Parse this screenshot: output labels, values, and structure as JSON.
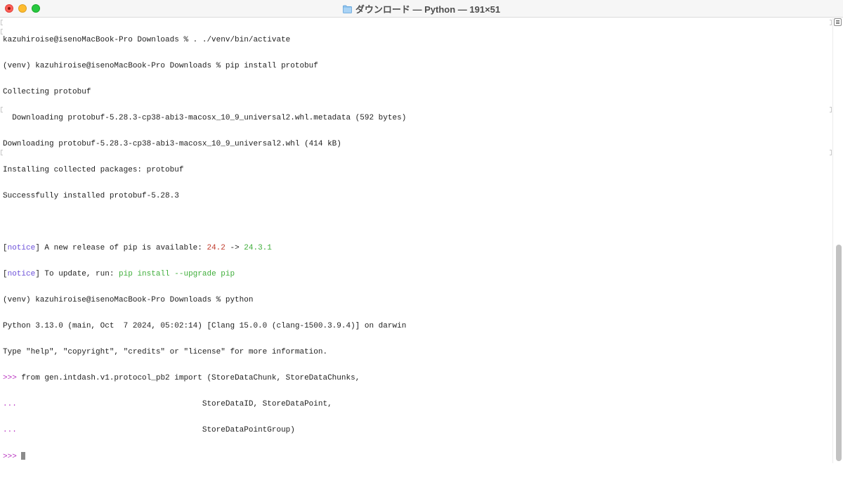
{
  "window": {
    "title": "ダウンロード — Python — 191×51",
    "folder_icon": "folder-icon",
    "colors": {
      "close": "#ff5f57",
      "minimize": "#febc2e",
      "zoom": "#28c840"
    }
  },
  "terminal": {
    "colors": {
      "notice": "#6b4fd9",
      "old_version": "#c0392b",
      "new_version": "#3fae3a",
      "python_prompt": "#b832c0"
    },
    "l1": "kazuhiroise@isenoMacBook-Pro Downloads % . ./venv/bin/activate",
    "l2": "(venv) kazuhiroise@isenoMacBook-Pro Downloads % pip install protobuf",
    "l3": "Collecting protobuf",
    "l4": "  Downloading protobuf-5.28.3-cp38-abi3-macosx_10_9_universal2.whl.metadata (592 bytes)",
    "l5": "Downloading protobuf-5.28.3-cp38-abi3-macosx_10_9_universal2.whl (414 kB)",
    "l6": "Installing collected packages: protobuf",
    "l7": "Successfully installed protobuf-5.28.3",
    "n1_open": "[",
    "n1_word": "notice",
    "n1_close": "] A new release of pip is available: ",
    "n1_old": "24.2",
    "n1_arrow": " -> ",
    "n1_new": "24.3.1",
    "n2_open": "[",
    "n2_word": "notice",
    "n2_close": "] To update, run: ",
    "n2_cmd": "pip install --upgrade pip",
    "l10": "(venv) kazuhiroise@isenoMacBook-Pro Downloads % python",
    "l11": "Python 3.13.0 (main, Oct  7 2024, 05:02:14) [Clang 15.0.0 (clang-1500.3.9.4)] on darwin",
    "l12": "Type \"help\", \"copyright\", \"credits\" or \"license\" for more information.",
    "p1": ">>>",
    "p1_text": " from gen.intdash.v1.protocol_pb2 import (StoreDataChunk, StoreDataChunks,",
    "p2": "...",
    "p2_text": "                                        StoreDataID, StoreDataPoint,",
    "p3": "...",
    "p3_text": "                                        StoreDataPointGroup)",
    "p4": ">>>"
  }
}
